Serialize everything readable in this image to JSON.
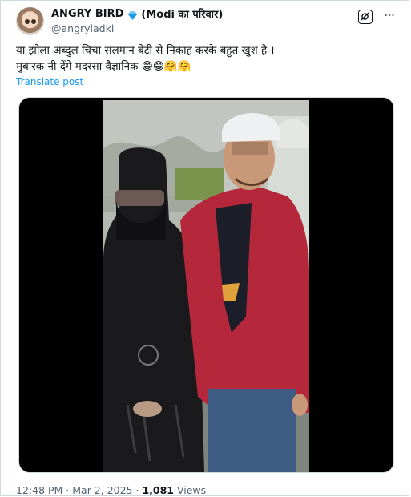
{
  "author": {
    "display_name": "ANGRY BIRD",
    "org_tag": "(Modi का परिवार)",
    "handle": "@angryladki"
  },
  "icons": {
    "verified": "verified-diamond-icon",
    "grok": "grok-icon",
    "more": "more-options-icon",
    "avatar_color": "#f2d7c3"
  },
  "tweet": {
    "line1": "या झोला अब्दुल चिचा सलमान बेटी से निकाह करके बहुत खुश है ।",
    "line2": "मुबारक नी देंगे मदरसा वैज्ञानिक 😁😁🤗🤗",
    "translate": "Translate post"
  },
  "meta": {
    "time": "12:48 PM",
    "separator": " · ",
    "date": "Mar 2, 2025",
    "views_count": "1,081",
    "views_label": " Views"
  },
  "colors": {
    "link": "#1d9bf0",
    "secondary_text": "#536471",
    "verified": "#1d9bf0",
    "jacket": "#b5283b"
  }
}
